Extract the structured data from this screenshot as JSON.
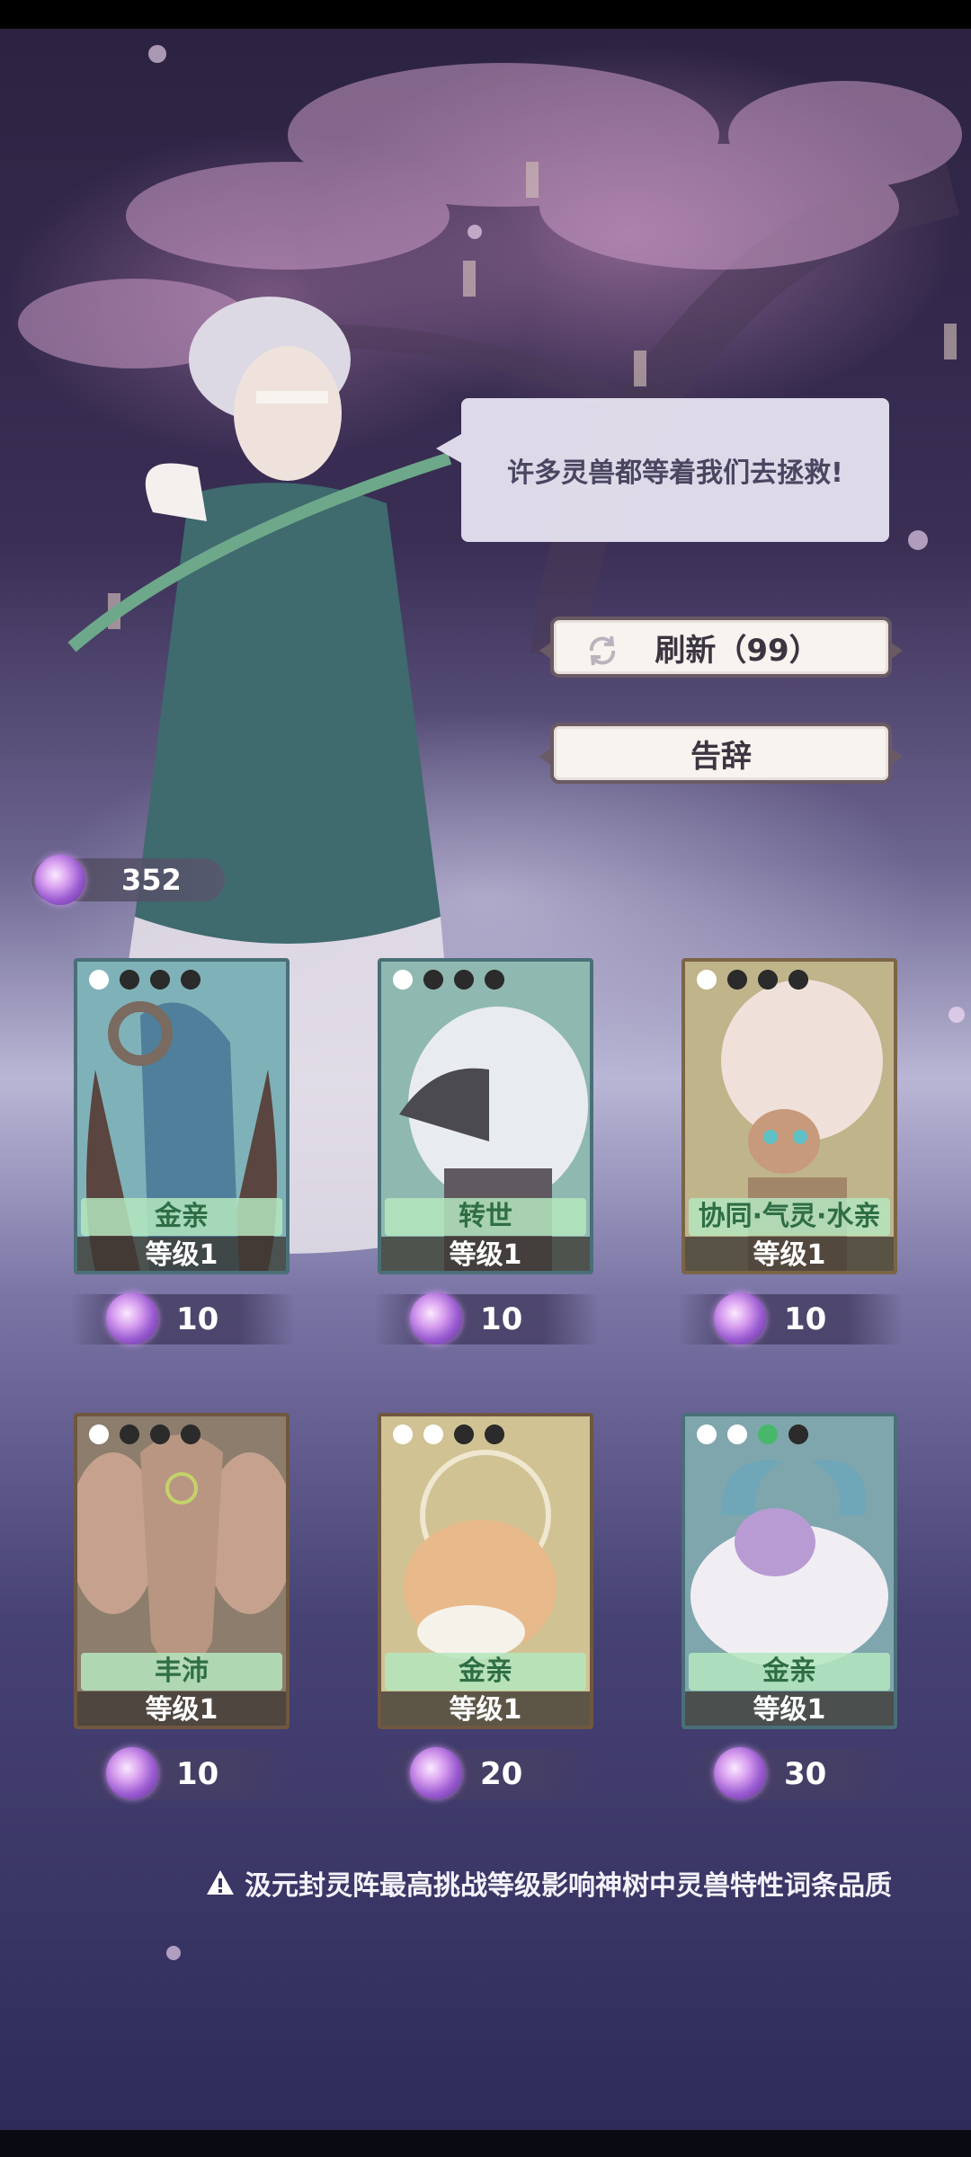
{
  "dialogue": {
    "text": "许多灵兽都等着我们去拯救!"
  },
  "buttons": {
    "refresh_label": "刷新（99）",
    "leave_label": "告辞"
  },
  "currency": {
    "amount": "352"
  },
  "cards": [
    {
      "trait": "金亲",
      "level": "等级1",
      "cost": "10",
      "paws": [
        "lit",
        "dark",
        "dark",
        "dark"
      ]
    },
    {
      "trait": "转世",
      "level": "等级1",
      "cost": "10",
      "paws": [
        "lit",
        "dark",
        "dark",
        "dark"
      ]
    },
    {
      "trait": "协同·气灵·水亲",
      "level": "等级1",
      "cost": "10",
      "paws": [
        "lit",
        "dark",
        "dark",
        "dark"
      ]
    },
    {
      "trait": "丰沛",
      "level": "等级1",
      "cost": "10",
      "paws": [
        "lit",
        "dark",
        "dark",
        "dark"
      ]
    },
    {
      "trait": "金亲",
      "level": "等级1",
      "cost": "20",
      "paws": [
        "lit",
        "lit",
        "dark",
        "dark"
      ]
    },
    {
      "trait": "金亲",
      "level": "等级1",
      "cost": "30",
      "paws": [
        "lit",
        "lit",
        "green",
        "dark"
      ]
    }
  ],
  "notice": {
    "text": "汲元封灵阵最高挑战等级影响神树中灵兽特性词条品质"
  },
  "colors": {
    "trait_bg": "#b4e6be",
    "trait_text": "#2f6e45",
    "orb": "#9a5bd0"
  }
}
